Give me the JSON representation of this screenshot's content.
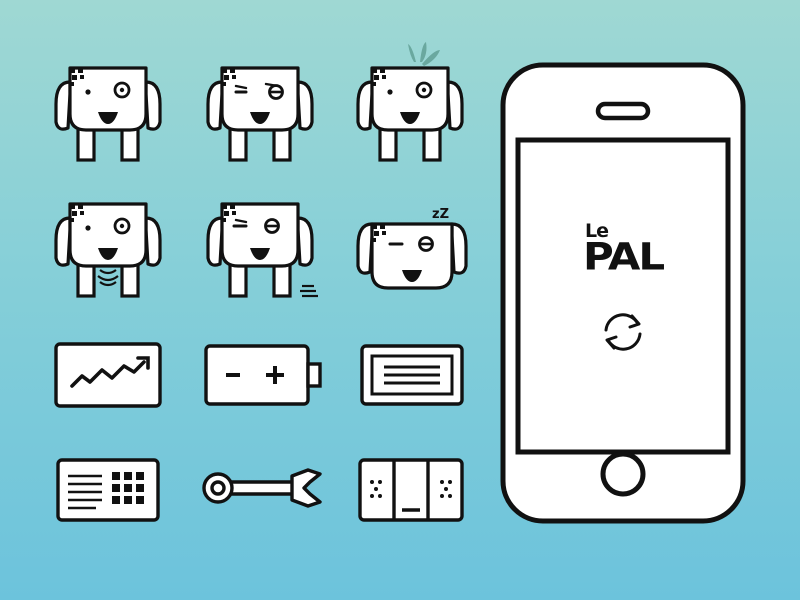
{
  "app": {
    "logo_le": "Le",
    "logo_pal": "PAL",
    "sleep_text": "zZ"
  },
  "icons": [
    {
      "name": "dog-neutral-icon"
    },
    {
      "name": "dog-wink-icon"
    },
    {
      "name": "dog-sprout-icon"
    },
    {
      "name": "dog-barking-icon"
    },
    {
      "name": "dog-moving-icon"
    },
    {
      "name": "dog-sleeping-icon"
    },
    {
      "name": "activity-chart-icon"
    },
    {
      "name": "battery-icon"
    },
    {
      "name": "message-panel-icon"
    },
    {
      "name": "keypad-panel-icon"
    },
    {
      "name": "wrench-icon"
    },
    {
      "name": "device-unit-icon"
    },
    {
      "name": "sync-icon"
    }
  ],
  "colors": {
    "background_top": "#9fd8d3",
    "background_bottom": "#6cc3dc",
    "stroke": "#111111",
    "fill": "#ffffff",
    "sprout": "#5fa59a"
  }
}
